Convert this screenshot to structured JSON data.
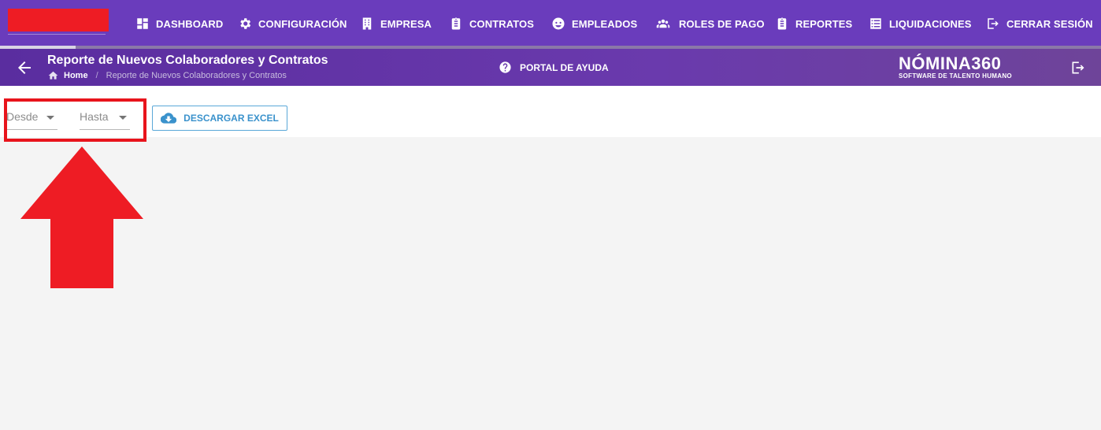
{
  "nav": {
    "items": [
      {
        "label": "DASHBOARD",
        "icon": "dashboard-icon"
      },
      {
        "label": "CONFIGURACIÓN",
        "icon": "gear-icon"
      },
      {
        "label": "EMPRESA",
        "icon": "building-icon"
      },
      {
        "label": "CONTRATOS",
        "icon": "clipboard-icon"
      },
      {
        "label": "EMPLEADOS",
        "icon": "face-icon"
      },
      {
        "label": "ROLES DE PAGO",
        "icon": "group-icon"
      },
      {
        "label": "REPORTES",
        "icon": "clipboard-icon"
      },
      {
        "label": "LIQUIDACIONES",
        "icon": "list-icon"
      },
      {
        "label": "CERRAR SESIÓN",
        "icon": "logout-icon"
      }
    ]
  },
  "subheader": {
    "title": "Reporte de Nuevos Colaboradores y Contratos",
    "breadcrumb": {
      "home": "Home",
      "current": "Reporte de Nuevos Colaboradores y Contratos"
    },
    "help_label": "PORTAL DE AYUDA",
    "brand_name": "NÓMINA360",
    "brand_tagline": "SOFTWARE DE TALENTO HUMANO"
  },
  "filters": {
    "desde_label": "Desde",
    "hasta_label": "Hasta",
    "download_label": "DESCARGAR EXCEL"
  },
  "colors": {
    "nav_bg": "#6a3cbc",
    "accent_blue": "#3a92cc",
    "annotation_red": "#e8141c"
  }
}
